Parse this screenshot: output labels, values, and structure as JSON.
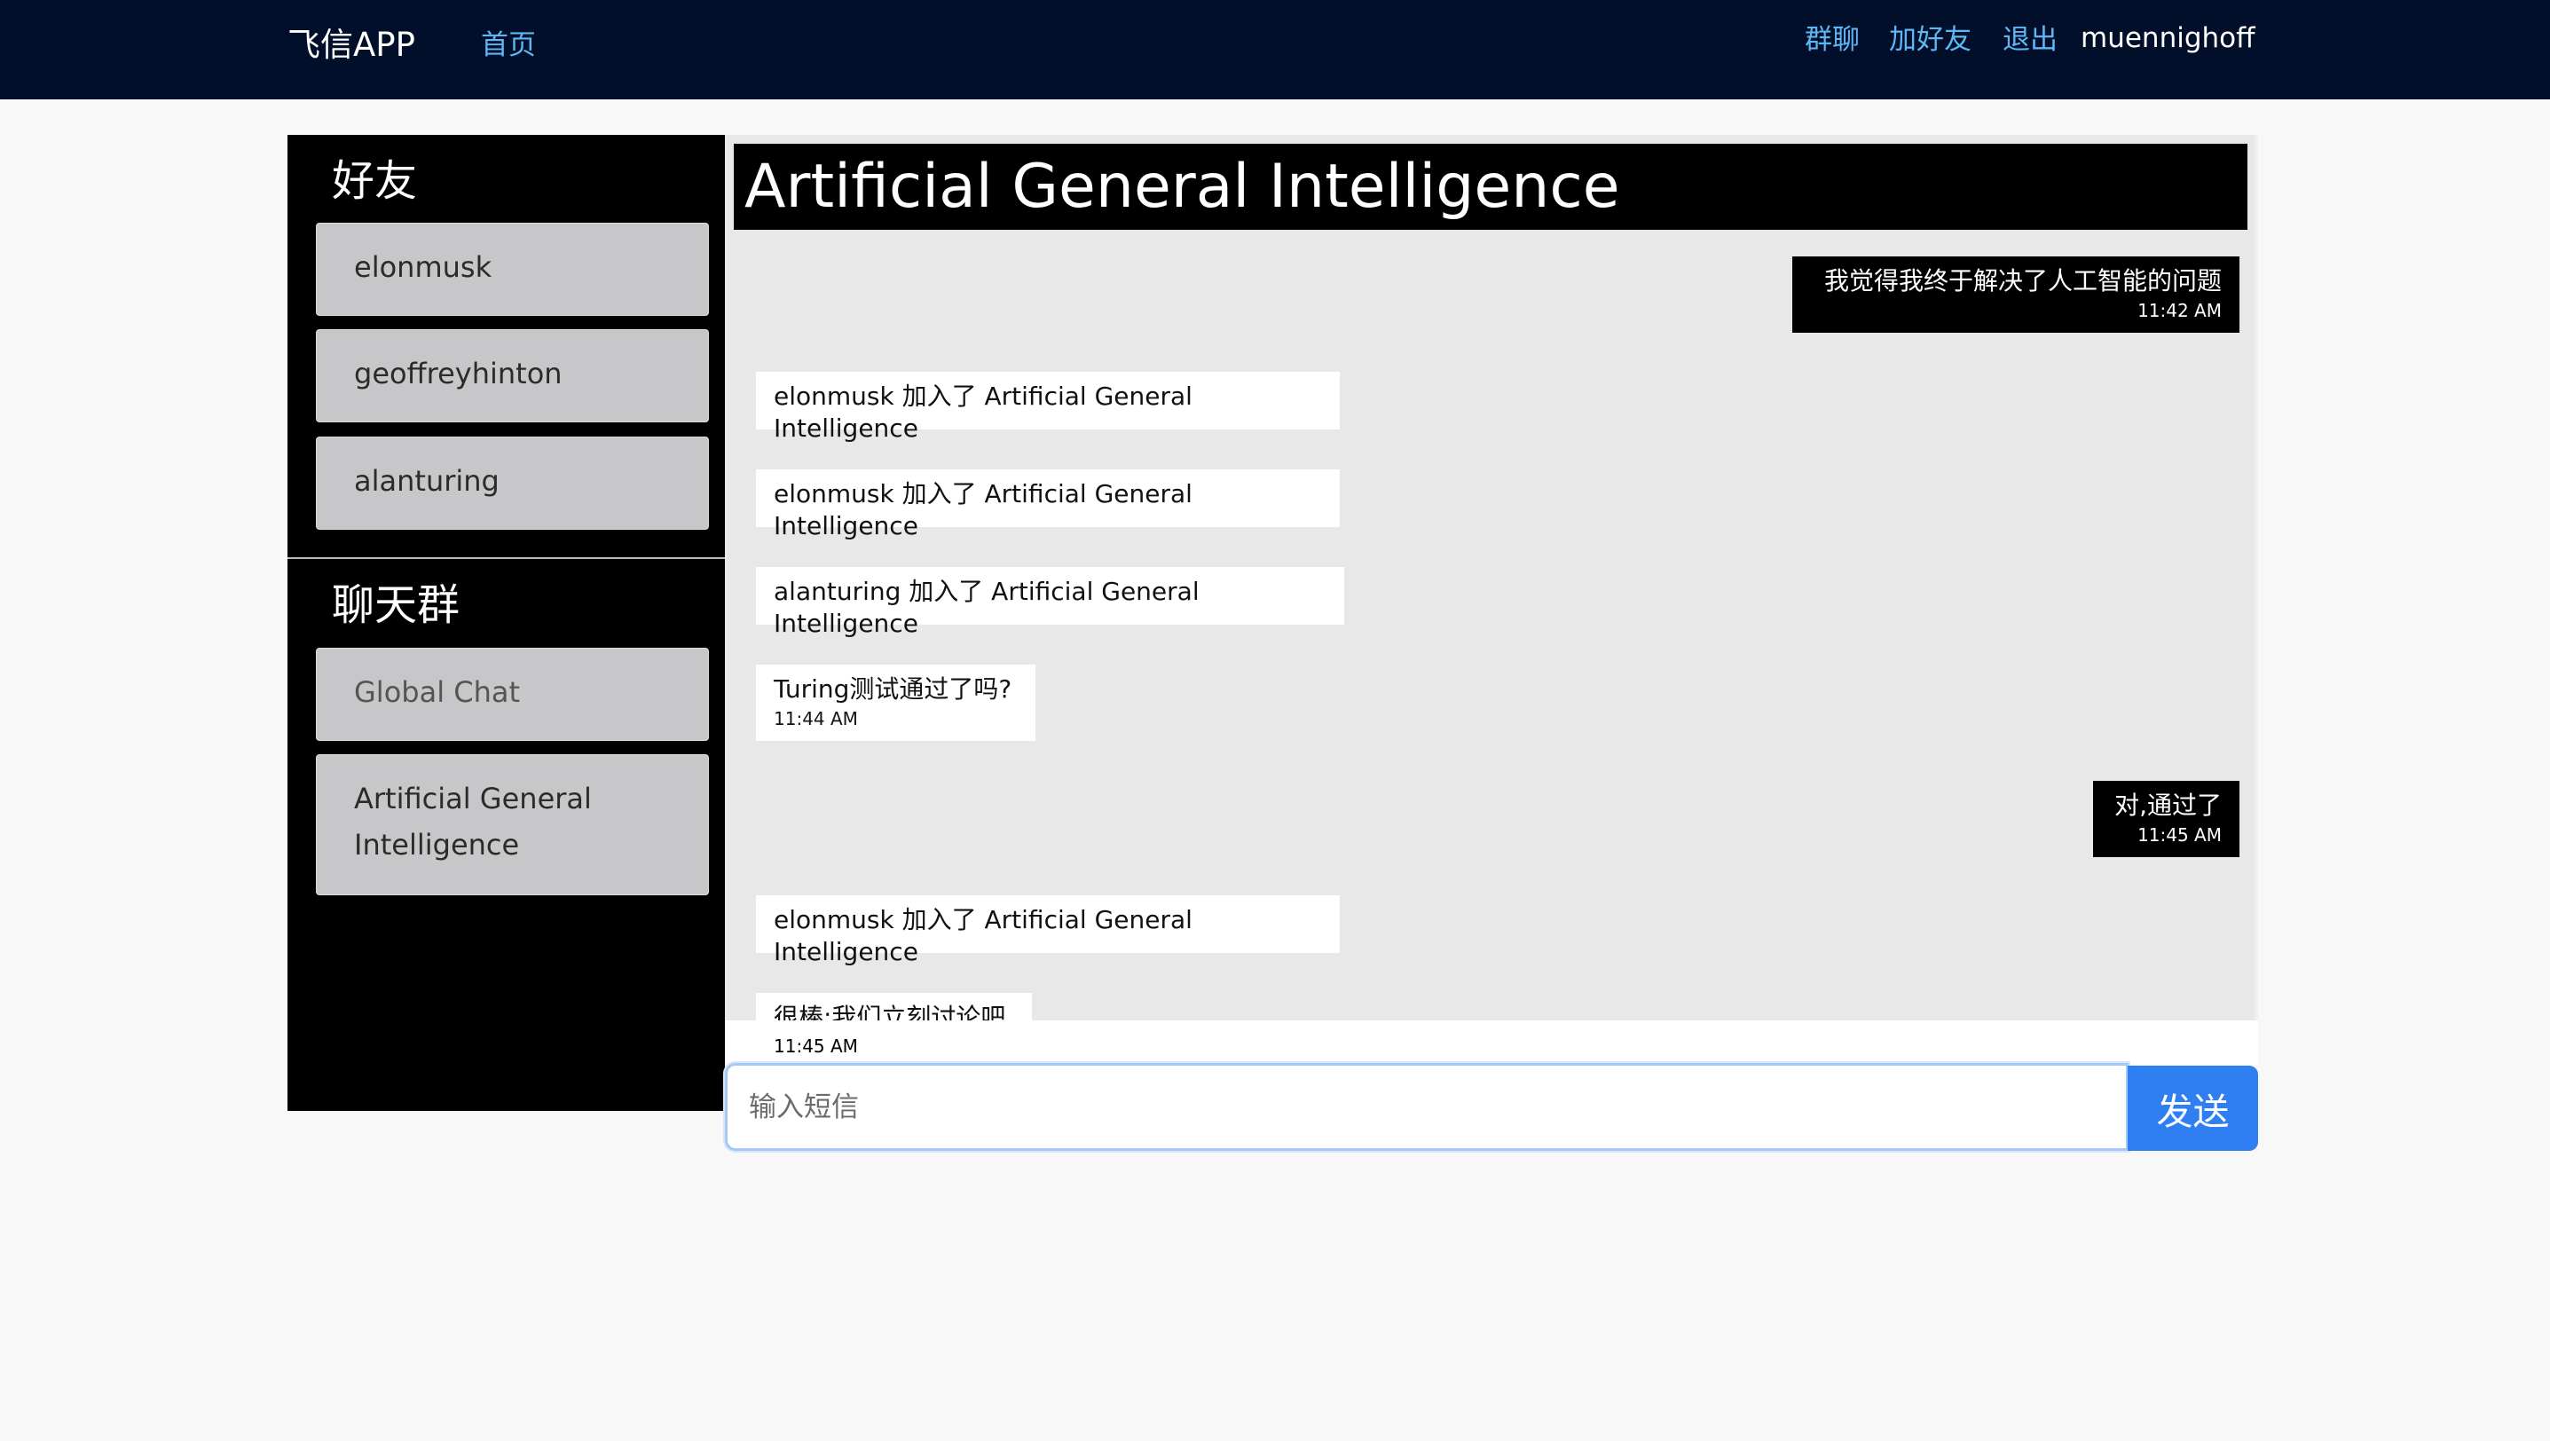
{
  "navbar": {
    "brand": "飞信APP",
    "home": "首页",
    "group_chat": "群聊",
    "add_friend": "加好友",
    "logout": "退出",
    "username": "muennighoff"
  },
  "sidebar": {
    "friends_title": "好友",
    "friends": [
      "elonmusk",
      "geoffreyhinton",
      "alanturing"
    ],
    "groups_title": "聊天群",
    "groups": [
      "Global Chat",
      "Artificial General Intelligence"
    ]
  },
  "chat": {
    "title": "Artificial General Intelligence",
    "messages": [
      {
        "type": "out",
        "text": "我觉得我终于解决了人工智能的问题",
        "time": "11:42 AM"
      },
      {
        "type": "system",
        "text": "elonmusk 加入了 Artificial General Intelligence"
      },
      {
        "type": "system",
        "text": "elonmusk 加入了 Artificial General Intelligence"
      },
      {
        "type": "system",
        "text": "alanturing 加入了 Artificial General Intelligence"
      },
      {
        "type": "in",
        "text": "Turing测试通过了吗?",
        "time": "11:44 AM"
      },
      {
        "type": "out",
        "text": "对,通过了",
        "time": "11:45 AM"
      },
      {
        "type": "system",
        "text": "elonmusk 加入了 Artificial General Intelligence"
      },
      {
        "type": "in",
        "text": "很棒;我们立刻讨论吧",
        "time": "11:45 AM"
      }
    ]
  },
  "composer": {
    "placeholder": "输入短信",
    "send_label": "发送"
  },
  "colors": {
    "navbar_bg": "#020f2a",
    "nav_link": "#5db7f5",
    "send_button": "#2f7ff3"
  }
}
